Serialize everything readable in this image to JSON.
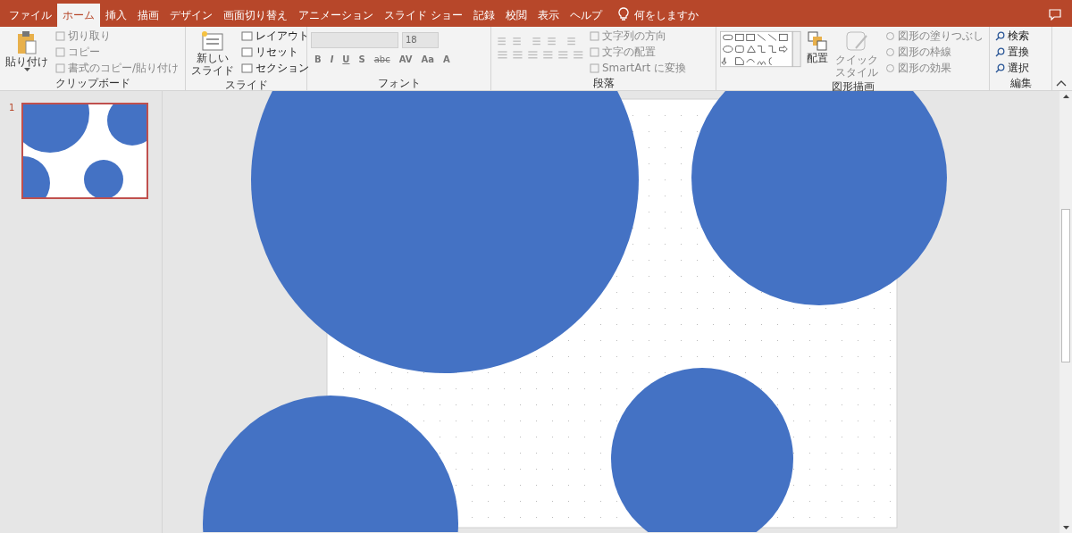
{
  "tabs": [
    {
      "label": "ファイル",
      "selected": false
    },
    {
      "label": "ホーム",
      "selected": true
    },
    {
      "label": "挿入",
      "selected": false
    },
    {
      "label": "描画",
      "selected": false
    },
    {
      "label": "デザイン",
      "selected": false
    },
    {
      "label": "画面切り替え",
      "selected": false
    },
    {
      "label": "アニメーション",
      "selected": false
    },
    {
      "label": "スライド ショー",
      "selected": false
    },
    {
      "label": "記録",
      "selected": false
    },
    {
      "label": "校閲",
      "selected": false
    },
    {
      "label": "表示",
      "selected": false
    },
    {
      "label": "ヘルプ",
      "selected": false
    }
  ],
  "tell_me": "何をしますか",
  "ribbon": {
    "clipboard": {
      "label": "クリップボード",
      "paste": "貼り付け",
      "items": [
        {
          "label": "切り取り",
          "disabled": true
        },
        {
          "label": "コピー",
          "disabled": true
        },
        {
          "label": "書式のコピー/貼り付け",
          "disabled": true
        }
      ]
    },
    "slides": {
      "label": "スライド",
      "new_slide": [
        "新しい",
        "スライド"
      ],
      "items": [
        {
          "label": "レイアウト",
          "disabled": false
        },
        {
          "label": "リセット",
          "disabled": false
        },
        {
          "label": "セクション",
          "disabled": false
        }
      ]
    },
    "font": {
      "label": "フォント",
      "font_size": "18",
      "disabled": true,
      "buttons": [
        "B",
        "I",
        "U",
        "S",
        "abc",
        "AV",
        "Aa",
        "A"
      ]
    },
    "paragraph": {
      "label": "段落",
      "items": [
        {
          "label": "文字列の方向",
          "disabled": true
        },
        {
          "label": "文字の配置",
          "disabled": true
        },
        {
          "label": "SmartArt に変換",
          "disabled": true
        }
      ]
    },
    "drawing": {
      "label": "図形描画",
      "arrange": "配置",
      "quick_style": [
        "クイック",
        "スタイル"
      ],
      "items": [
        {
          "label": "図形の塗りつぶし",
          "disabled": true
        },
        {
          "label": "図形の枠線",
          "disabled": true
        },
        {
          "label": "図形の効果",
          "disabled": true
        }
      ]
    },
    "editing": {
      "label": "編集",
      "items": [
        {
          "label": "検索",
          "disabled": false
        },
        {
          "label": "置換",
          "disabled": false
        },
        {
          "label": "選択",
          "disabled": false
        }
      ]
    }
  },
  "thumbnails": [
    {
      "number": "1",
      "selected": true
    }
  ]
}
